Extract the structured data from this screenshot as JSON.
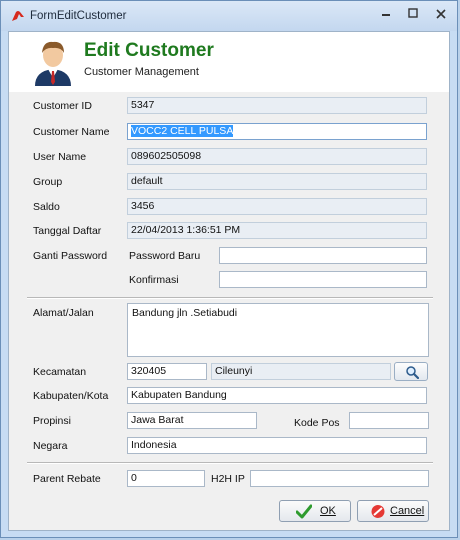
{
  "window": {
    "title": "FormEditCustomer",
    "accent": "#1f7a1f"
  },
  "header": {
    "title": "Edit Customer",
    "subtitle": "Customer Management",
    "avatar_icon": "user-avatar-icon"
  },
  "form": {
    "customer_id": {
      "label": "Customer ID",
      "value": "5347"
    },
    "customer_name": {
      "label": "Customer Name",
      "value": "VOCC2 CELL PULSA"
    },
    "user_name": {
      "label": "User Name",
      "value": "089602505098"
    },
    "group": {
      "label": "Group",
      "value": "default"
    },
    "saldo": {
      "label": "Saldo",
      "value": "3456"
    },
    "tanggal_daftar": {
      "label": "Tanggal Daftar",
      "value": "22/04/2013 1:36:51 PM"
    },
    "ganti_password": {
      "label": "Ganti Password",
      "password_baru_label": "Password Baru",
      "konfirmasi_label": "Konfirmasi",
      "password_baru_value": "",
      "konfirmasi_value": ""
    },
    "alamat": {
      "label": "Alamat/Jalan",
      "value": "Bandung jln .Setiabudi"
    },
    "kecamatan": {
      "label": "Kecamatan",
      "code": "320405",
      "name": "Cileunyi"
    },
    "kabupaten": {
      "label": "Kabupaten/Kota",
      "value": "Kabupaten Bandung"
    },
    "propinsi": {
      "label": "Propinsi",
      "value": "Jawa Barat"
    },
    "kode_pos": {
      "label": "Kode Pos",
      "value": ""
    },
    "negara": {
      "label": "Negara",
      "value": "Indonesia"
    },
    "parent_rebate": {
      "label": "Parent Rebate",
      "value": "0"
    },
    "h2h_ip": {
      "label": "H2H IP",
      "value": ""
    }
  },
  "buttons": {
    "ok": "OK",
    "cancel": "Cancel"
  }
}
